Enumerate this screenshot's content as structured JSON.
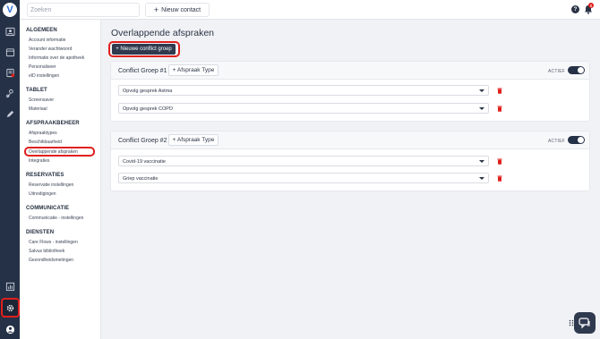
{
  "colors": {
    "rail": "#253146",
    "accent_dark": "#2f3a4f",
    "highlight": "#e0201d",
    "background": "#f1f2f5"
  },
  "app": {
    "logo_letter": "V"
  },
  "rail_icons": [
    "contact-card-icon",
    "calendar-icon",
    "list-icon",
    "person-pin-icon",
    "pen-icon",
    "chart-icon",
    "gear-icon",
    "profile-icon"
  ],
  "topbar": {
    "search_placeholder": "Zoeken",
    "new_contact_label": "Nieuw contact",
    "new_contact_icon": "plus-icon",
    "help_label": "?",
    "notification_count": "8"
  },
  "settings_nav": {
    "sections": [
      {
        "title": "ALGEMEEN",
        "items": [
          "Account informatie",
          "Verander wachtwoord",
          "Informatie over de apotheek",
          "Personaliseer",
          "eID instellingen"
        ]
      },
      {
        "title": "TABLET",
        "items": [
          "Screensaver",
          "Materiaal"
        ]
      },
      {
        "title": "AFSPRAAKBEHEER",
        "items": [
          "Afspraaktypes",
          "Beschikbaarheid",
          "Overlappende afspraken",
          "Integraties"
        ]
      },
      {
        "title": "RESERVATIES",
        "items": [
          "Reservatie instellingen",
          "Uitnodigingen"
        ]
      },
      {
        "title": "COMMUNICATIE",
        "items": [
          "Communicatie - instellingen"
        ]
      },
      {
        "title": "DIENSTEN",
        "items": [
          "Care Flows - instellingen",
          "Salvus bibliotheek",
          "Gezondheidsmetingen"
        ]
      }
    ]
  },
  "main": {
    "title": "Overlappende afspraken",
    "new_group_button": "+ Nieuwe conflict groep",
    "groups": [
      {
        "title": "Conflict Groep #1",
        "add_type_button": "+ Afspraak Type",
        "status_label": "ACTIEF",
        "active": true,
        "rows": [
          "Opvolg gesprek Astma",
          "Opvolg gesprek COPD"
        ]
      },
      {
        "title": "Conflict Groep #2",
        "add_type_button": "+ Afspraak Type",
        "status_label": "ACTIEF",
        "active": true,
        "rows": [
          "Covid-19 vaccinatie",
          "Griep vaccinatie"
        ]
      }
    ]
  }
}
